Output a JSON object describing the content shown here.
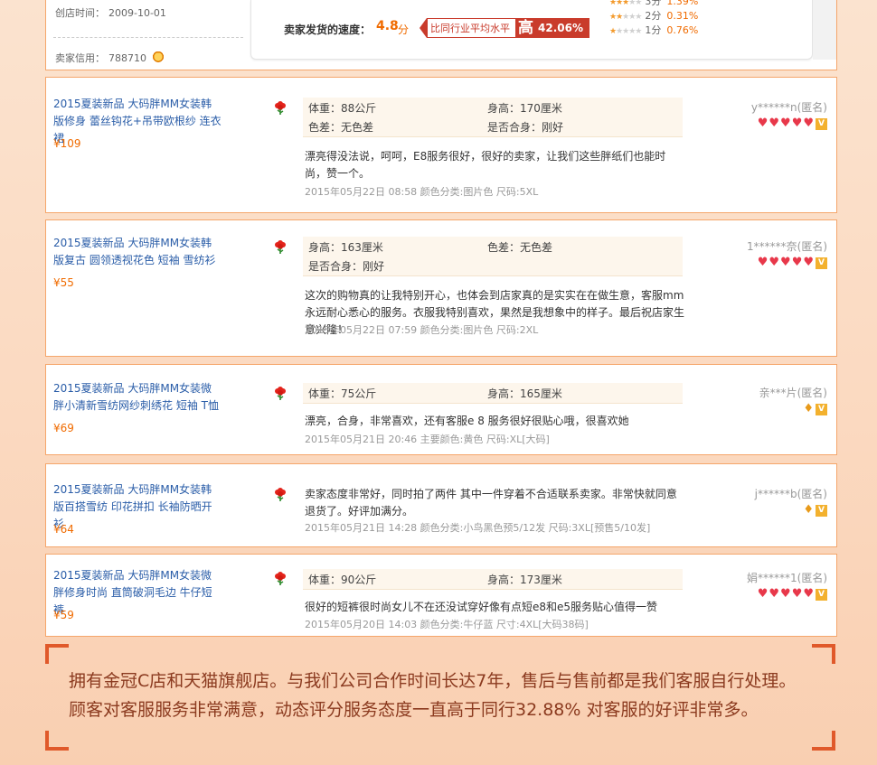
{
  "store": {
    "open_label": "创店时间：",
    "open_date": "2009-10-01",
    "credit_label": "卖家信用：",
    "credit_value": "788710",
    "crown_icon": "crown-icon"
  },
  "rating": {
    "speed_label": "卖家发货的速度：",
    "speed_value": "4.8",
    "speed_unit": "分",
    "compare_label": "比同行业平均水平",
    "compare_level": "高",
    "compare_pct": "42.06%",
    "distribution": [
      {
        "stars": 3,
        "label": "3分",
        "pct": "1.39%"
      },
      {
        "stars": 2,
        "label": "2分",
        "pct": "0.31%"
      },
      {
        "stars": 1,
        "label": "1分",
        "pct": "0.76%"
      }
    ]
  },
  "reviews": [
    {
      "product": "2015夏装新品 大码胖MM女装韩版修身 蕾丝钩花+吊带欧根纱 连衣裙",
      "price": "¥109",
      "attrs": [
        "体重：88公斤",
        "身高：170厘米",
        "色差：无色差",
        "是否合身：刚好"
      ],
      "text": "漂亮得没法说，呵呵，E8服务很好，很好的卖家，让我们这些胖纸们也能时尚，赞一个。",
      "meta": "2015年05月22日 08:58 颜色分类:图片色  尺码:5XL",
      "buyer": "y******n(匿名)",
      "hearts": 5,
      "badge": "heart"
    },
    {
      "product": "2015夏装新品 大码胖MM女装韩版复古 圆领透视花色 短袖 雪纺衫",
      "price": "¥55",
      "attrs": [
        "身高：163厘米",
        "色差：无色差",
        "是否合身：刚好"
      ],
      "text": "这次的购物真的让我特别开心，也体会到店家真的是实实在在做生意，客服mm永远耐心悉心的服务。衣服我特别喜欢，果然是我想象中的样子。最后祝店家生意兴隆！",
      "meta": "2015年05月22日 07:59 颜色分类:图片色  尺码:2XL",
      "buyer": "1******奈(匿名)",
      "hearts": 5,
      "badge": "heart"
    },
    {
      "product": "2015夏装新品 大码胖MM女装微胖小清新雪纺网纱刺绣花 短袖 T恤",
      "price": "¥69",
      "attrs": [
        "体重：75公斤",
        "身高：165厘米"
      ],
      "text": "漂亮，合身，非常喜欢，还有客服e 8 服务很好很贴心哦，很喜欢她",
      "meta": "2015年05月21日 20:46 主要颜色:黄色  尺码:XL[大码]",
      "buyer": "亲***片(匿名)",
      "hearts": 1,
      "badge": "diamond"
    },
    {
      "product": "2015夏装新品 大码胖MM女装韩版百搭雪纺 印花拼扣 长袖防晒开衫",
      "price": "¥64",
      "attrs": [],
      "text": "卖家态度非常好，同时拍了两件 其中一件穿着不合适联系卖家。非常快就同意退货了。好评加满分。",
      "meta": "2015年05月21日 14:28 颜色分类:小鸟黑色预5/12发  尺码:3XL[预售5/10发]",
      "buyer": "j******b(匿名)",
      "hearts": 1,
      "badge": "diamond"
    },
    {
      "product": "2015夏装新品 大码胖MM女装微胖修身时尚 直筒破洞毛边 牛仔短裤",
      "price": "¥59",
      "attrs": [
        "体重：90公斤",
        "身高：173厘米"
      ],
      "text": "很好的短裤很时尚女儿不在还没试穿好像有点短e8和e5服务贴心值得一赞",
      "meta": "2015年05月20日 14:03 颜色分类:牛仔蓝  尺寸:4XL[大码38码]",
      "buyer": "娟******1(匿名)",
      "hearts": 5,
      "badge": "heart"
    }
  ],
  "summary": {
    "line1": "拥有金冠C店和天猫旗舰店。与我们公司合作时间长达7年，售后与售前都是我们客服自行处理。",
    "line2": "顾客对客服服务非常满意，动态评分服务态度一直高于同行32.88% 对客服的好评非常多。"
  },
  "colors": {
    "accent": "#f06b00",
    "border": "#f5a66b",
    "link": "#2a5da8",
    "summary_text": "#8b3a1f",
    "heart": "#e8384a"
  }
}
